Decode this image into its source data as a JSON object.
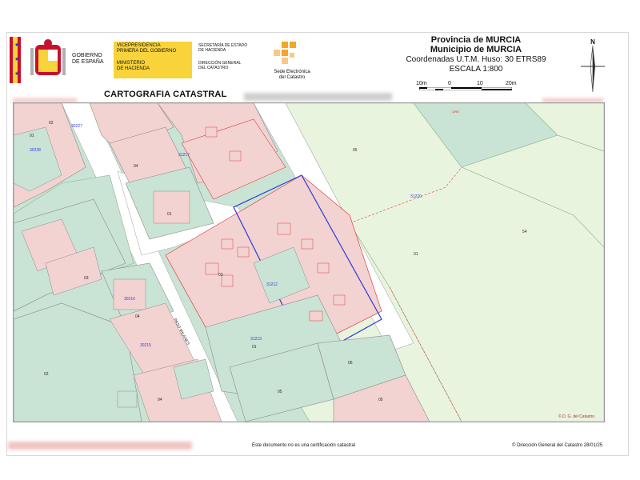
{
  "header": {
    "gobierno": "GOBIERNO DE ESPAÑA",
    "gobierno_line1": "GOBIERNO",
    "gobierno_line2": "DE ESPAÑA",
    "vicepresidencia_line1": "VICEPRESIDENCIA",
    "vicepresidencia_line2": "PRIMERA DEL GOBIERNO",
    "ministerio_line1": "MINISTERIO",
    "ministerio_line2": "DE HACIENDA",
    "secretaria_line1": "SECRETARÍA DE ESTADO",
    "secretaria_line2": "DE HACIENDA",
    "direccion_line1": "DIRECCIÓN GENERAL",
    "direccion_line2": "DEL CATASTRO",
    "sede_line1": "Sede Electrónica",
    "sede_line2": "del Catastro",
    "provincia": "Provincia de MURCIA",
    "municipio": "Municipio de MURCIA",
    "coordenadas": "Coordenadas U.T.M. Huso: 30 ETRS89",
    "escala": "ESCALA 1:800",
    "scale_ticks": [
      "10m",
      "0",
      "10",
      "20m"
    ],
    "north_label": "N",
    "section_title": "CARTOGRAFIA CATASTRAL"
  },
  "map": {
    "block_labels": [
      "30227",
      "30228",
      "31217",
      "31220",
      "31212",
      "31213",
      "30216",
      "30215"
    ],
    "parcel_labels": [
      "02",
      "01",
      "03",
      "04",
      "01",
      "05",
      "06",
      "05",
      "04",
      "03",
      "02",
      "01",
      "04",
      "02",
      "01",
      "03",
      "03",
      "06",
      "05",
      "05",
      "54",
      "03",
      "01",
      "02",
      "20",
      "21",
      "22",
      "23"
    ],
    "street_label": "PASO MILANES",
    "copyright_small": "© D. G. del Catastro"
  },
  "footer": {
    "disclaimer": "Este documento no es una certificación catastral",
    "copyright": "© Dirección General del Catastro 28/01/25"
  },
  "colors": {
    "parcel_green": "#c9e3d4",
    "building_pink": "#f3d2d2",
    "light_green": "#e9f4df",
    "rural_green": "#d6eccd",
    "red_line": "#e04040",
    "blue_outline": "#2b3bd6",
    "brand_yellow": "#f8d33a",
    "brand_red": "#c8102e"
  }
}
